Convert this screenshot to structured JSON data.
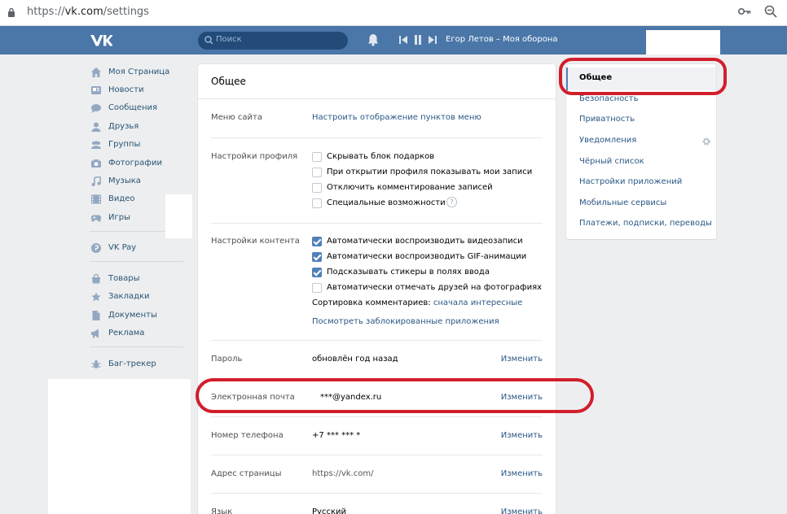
{
  "browser": {
    "url_prefix": "https://",
    "url_host": "vk.com",
    "url_path": "/settings"
  },
  "header": {
    "search_placeholder": "Поиск",
    "now_playing": "Егор Летов – Моя оборона"
  },
  "sidebar": {
    "items": [
      {
        "label": "Моя Страница",
        "icon": "home-icon"
      },
      {
        "label": "Новости",
        "icon": "news-icon"
      },
      {
        "label": "Сообщения",
        "icon": "messages-icon"
      },
      {
        "label": "Друзья",
        "icon": "friends-icon"
      },
      {
        "label": "Группы",
        "icon": "groups-icon"
      },
      {
        "label": "Фотографии",
        "icon": "camera-icon"
      },
      {
        "label": "Музыка",
        "icon": "music-icon"
      },
      {
        "label": "Видео",
        "icon": "video-icon"
      },
      {
        "label": "Игры",
        "icon": "games-icon"
      },
      {
        "label": "VK Pay",
        "icon": "vkpay-icon"
      },
      {
        "label": "Товары",
        "icon": "market-icon"
      },
      {
        "label": "Закладки",
        "icon": "star-icon"
      },
      {
        "label": "Документы",
        "icon": "document-icon"
      },
      {
        "label": "Реклама",
        "icon": "megaphone-icon"
      },
      {
        "label": "Баг-трекер",
        "icon": "bug-icon"
      }
    ]
  },
  "main": {
    "title": "Общее",
    "site_menu": {
      "label": "Меню сайта",
      "link": "Настроить отображение пунктов меню"
    },
    "profile": {
      "label": "Настройки профиля",
      "options": [
        {
          "text": "Скрывать блок подарков",
          "checked": false
        },
        {
          "text": "При открытии профиля показывать мои записи",
          "checked": false
        },
        {
          "text": "Отключить комментирование записей",
          "checked": false
        },
        {
          "text": "Специальные возможности",
          "checked": false
        }
      ],
      "help": "?"
    },
    "content": {
      "label": "Настройки контента",
      "options": [
        {
          "text": "Автоматически воспроизводить видеозаписи",
          "checked": true
        },
        {
          "text": "Автоматически воспроизводить GIF-анимации",
          "checked": true
        },
        {
          "text": "Подсказывать стикеры в полях ввода",
          "checked": true
        },
        {
          "text": "Автоматически отмечать друзей на фотографиях",
          "checked": false
        }
      ],
      "sort_label": "Сортировка комментариев:",
      "sort_value": "сначала интересные",
      "blocked_apps": "Посмотреть заблокированные приложения"
    },
    "rows": [
      {
        "label": "Пароль",
        "value": "обновлён год назад",
        "action": "Изменить"
      },
      {
        "label": "Электронная почта",
        "value": "***@yandex.ru",
        "action": "Изменить"
      },
      {
        "label": "Номер телефона",
        "value": "+7 *** *** *",
        "action": "Изменить"
      },
      {
        "label": "Адрес страницы",
        "value": "https://vk.com/",
        "action": "Изменить"
      },
      {
        "label": "Язык",
        "value": "Русский",
        "action": "Изменить"
      }
    ]
  },
  "right_menu": {
    "items": [
      "Общее",
      "Безопасность",
      "Приватность",
      "Уведомления",
      "Чёрный список",
      "Настройки приложений",
      "Мобильные сервисы",
      "Платежи, подписки, переводы"
    ],
    "active": "Общее"
  },
  "colors": {
    "vk_blue": "#4a76a8",
    "link": "#2a5885",
    "highlight_red": "#d21e2b"
  }
}
